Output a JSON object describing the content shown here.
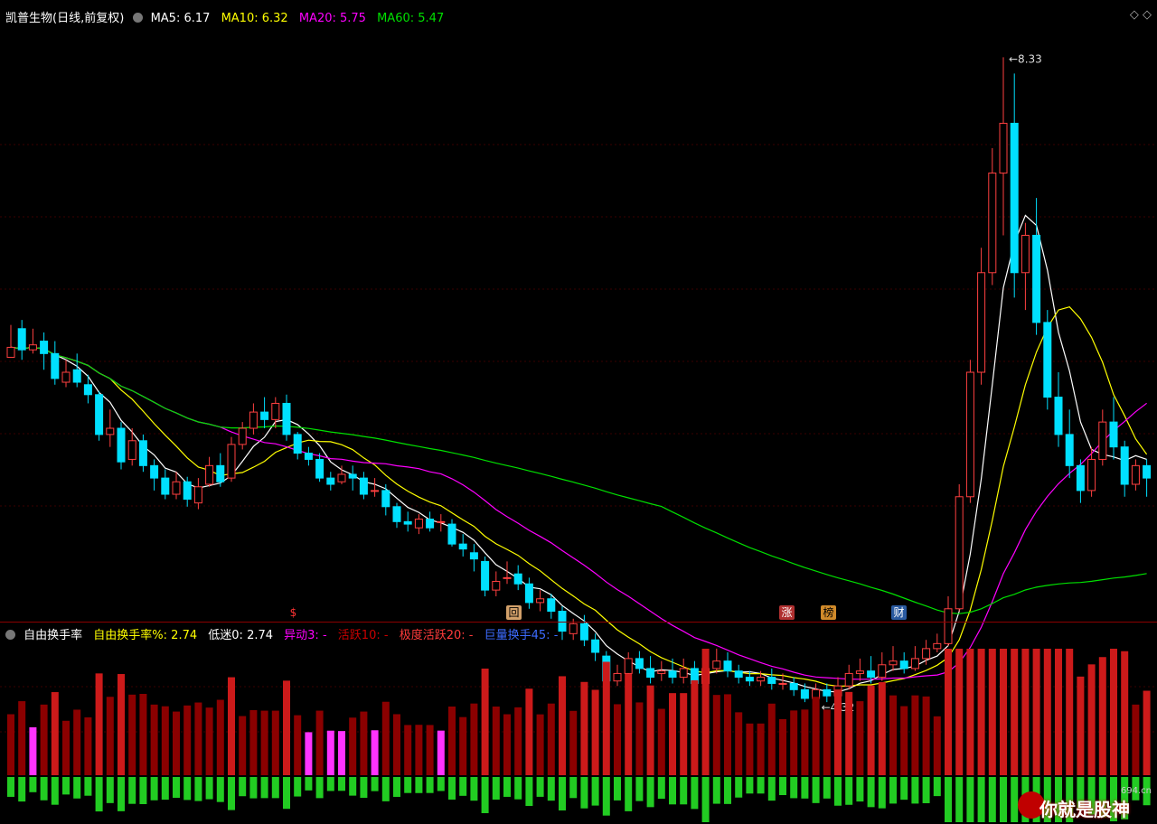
{
  "header": {
    "stock_name": "凯普生物(日线,前复权)",
    "ma5": {
      "label": "MA5:",
      "value": "6.17",
      "color": "#ffffff"
    },
    "ma10": {
      "label": "MA10:",
      "value": "6.32",
      "color": "#ffff00"
    },
    "ma20": {
      "label": "MA20:",
      "value": "5.75",
      "color": "#ff00ff"
    },
    "ma60": {
      "label": "MA60:",
      "value": "5.47",
      "color": "#00e000"
    }
  },
  "price_annotations": {
    "high": "8.33",
    "low": "4.32"
  },
  "markers": [
    {
      "label": "$",
      "color": "#ff3333",
      "bg": "#000000"
    },
    {
      "label": "回",
      "color": "#000000",
      "bg": "#d2a06a"
    },
    {
      "label": "涨",
      "color": "#ffffff",
      "bg": "#b03030"
    },
    {
      "label": "榜",
      "color": "#000000",
      "bg": "#d08a2a"
    },
    {
      "label": "财",
      "color": "#ffffff",
      "bg": "#2a5aa0"
    }
  ],
  "indicator": {
    "name": "自由换手率",
    "items": [
      {
        "label": "自由换手率%:",
        "value": "2.74",
        "color": "#ffff00"
      },
      {
        "label": "低迷0:",
        "value": "2.74",
        "color": "#ffffff"
      },
      {
        "label": "异动3:",
        "value": "-",
        "color": "#ff00ff"
      },
      {
        "label": "活跃10:",
        "value": "-",
        "color": "#cc0000"
      },
      {
        "label": "极度活跃20:",
        "value": "-",
        "color": "#ff3b3b"
      },
      {
        "label": "巨量换手45:",
        "value": "-",
        "color": "#3c6bff"
      }
    ]
  },
  "watermark": {
    "text": "你就是股神",
    "url": "694.cn"
  },
  "chart_data": {
    "type": "candlestick",
    "ylim": [
      4.0,
      8.5
    ],
    "candles": [
      [
        5.92,
        6.0,
        6.18,
        5.92
      ],
      [
        6.15,
        5.98,
        6.22,
        5.9
      ],
      [
        5.98,
        6.02,
        6.15,
        5.95
      ],
      [
        6.05,
        5.95,
        6.12,
        5.82
      ],
      [
        5.95,
        5.75,
        6.05,
        5.7
      ],
      [
        5.72,
        5.8,
        5.9,
        5.68
      ],
      [
        5.82,
        5.72,
        5.95,
        5.68
      ],
      [
        5.7,
        5.62,
        5.78,
        5.55
      ],
      [
        5.62,
        5.3,
        5.65,
        5.25
      ],
      [
        5.3,
        5.35,
        5.5,
        5.2
      ],
      [
        5.35,
        5.08,
        5.4,
        5.02
      ],
      [
        5.1,
        5.25,
        5.35,
        5.05
      ],
      [
        5.25,
        5.05,
        5.3,
        5.0
      ],
      [
        5.05,
        4.95,
        5.1,
        4.85
      ],
      [
        4.95,
        4.82,
        5.02,
        4.78
      ],
      [
        4.82,
        4.92,
        5.0,
        4.78
      ],
      [
        4.92,
        4.78,
        4.96,
        4.72
      ],
      [
        4.75,
        4.88,
        4.95,
        4.7
      ],
      [
        4.9,
        5.05,
        5.12,
        4.88
      ],
      [
        5.05,
        4.92,
        5.15,
        4.88
      ],
      [
        4.95,
        5.22,
        5.28,
        4.92
      ],
      [
        5.22,
        5.35,
        5.4,
        5.18
      ],
      [
        5.35,
        5.48,
        5.55,
        5.3
      ],
      [
        5.48,
        5.42,
        5.6,
        5.35
      ],
      [
        5.42,
        5.55,
        5.6,
        5.35
      ],
      [
        5.55,
        5.3,
        5.62,
        5.25
      ],
      [
        5.3,
        5.15,
        5.32,
        5.1
      ],
      [
        5.15,
        5.1,
        5.2,
        5.05
      ],
      [
        5.1,
        4.95,
        5.15,
        4.92
      ],
      [
        4.95,
        4.9,
        5.0,
        4.85
      ],
      [
        4.92,
        4.98,
        5.05,
        4.9
      ],
      [
        4.98,
        4.95,
        5.05,
        4.85
      ],
      [
        4.95,
        4.82,
        5.0,
        4.78
      ],
      [
        4.85,
        4.85,
        4.95,
        4.8
      ],
      [
        4.85,
        4.72,
        4.9,
        4.65
      ],
      [
        4.72,
        4.6,
        4.75,
        4.55
      ],
      [
        4.6,
        4.58,
        4.68,
        4.52
      ],
      [
        4.55,
        4.62,
        4.66,
        4.5
      ],
      [
        4.62,
        4.55,
        4.68,
        4.52
      ],
      [
        4.6,
        4.6,
        4.66,
        4.52
      ],
      [
        4.58,
        4.42,
        4.62,
        4.4
      ],
      [
        4.42,
        4.38,
        4.5,
        4.32
      ],
      [
        4.35,
        4.3,
        4.42,
        4.2
      ],
      [
        4.28,
        4.05,
        4.32,
        4.0
      ],
      [
        4.05,
        4.12,
        4.2,
        4.0
      ],
      [
        4.15,
        4.15,
        4.28,
        4.1
      ],
      [
        4.18,
        4.1,
        4.25,
        4.05
      ],
      [
        4.1,
        3.95,
        4.15,
        3.9
      ],
      [
        3.95,
        3.98,
        4.05,
        3.88
      ],
      [
        3.98,
        3.88,
        4.02,
        3.82
      ],
      [
        3.88,
        3.72,
        3.92,
        3.65
      ],
      [
        3.7,
        3.78,
        3.82,
        3.65
      ],
      [
        3.78,
        3.65,
        3.85,
        3.6
      ],
      [
        3.65,
        3.55,
        3.7,
        3.48
      ],
      [
        3.52,
        3.32,
        3.56,
        3.28
      ],
      [
        3.32,
        3.38,
        3.45,
        3.28
      ],
      [
        3.38,
        3.5,
        3.55,
        3.3
      ],
      [
        3.5,
        3.42,
        3.56,
        3.38
      ],
      [
        3.42,
        3.35,
        3.52,
        3.3
      ],
      [
        3.38,
        3.4,
        3.48,
        3.32
      ],
      [
        3.4,
        3.35,
        3.5,
        3.3
      ],
      [
        3.35,
        3.42,
        3.5,
        3.3
      ],
      [
        3.42,
        3.3,
        3.48,
        3.25
      ],
      [
        3.3,
        3.42,
        3.5,
        3.18
      ],
      [
        3.42,
        3.48,
        3.58,
        3.38
      ],
      [
        3.48,
        3.4,
        3.55,
        3.35
      ],
      [
        3.4,
        3.35,
        3.45,
        3.3
      ],
      [
        3.35,
        3.32,
        3.4,
        3.28
      ],
      [
        3.32,
        3.35,
        3.4,
        3.28
      ],
      [
        3.35,
        3.3,
        3.42,
        3.25
      ],
      [
        3.3,
        3.3,
        3.38,
        3.25
      ],
      [
        3.3,
        3.25,
        3.35,
        3.2
      ],
      [
        3.25,
        3.18,
        3.3,
        3.15
      ],
      [
        3.18,
        3.25,
        3.3,
        3.12
      ],
      [
        3.25,
        3.2,
        3.3,
        3.15
      ],
      [
        3.2,
        3.28,
        3.35,
        3.15
      ],
      [
        3.28,
        3.38,
        3.45,
        3.25
      ],
      [
        3.38,
        3.4,
        3.5,
        3.32
      ],
      [
        3.4,
        3.35,
        3.52,
        3.3
      ],
      [
        3.35,
        3.45,
        3.55,
        3.32
      ],
      [
        3.45,
        3.48,
        3.6,
        3.4
      ],
      [
        3.48,
        3.42,
        3.55,
        3.38
      ],
      [
        3.42,
        3.5,
        3.6,
        3.4
      ],
      [
        3.5,
        3.58,
        3.65,
        3.45
      ],
      [
        3.58,
        3.62,
        3.7,
        3.55
      ],
      [
        3.62,
        3.9,
        4.0,
        3.6
      ],
      [
        3.9,
        4.8,
        4.9,
        3.88
      ],
      [
        4.8,
        5.8,
        5.9,
        4.75
      ],
      [
        5.8,
        6.6,
        6.8,
        5.7
      ],
      [
        6.6,
        7.4,
        7.6,
        6.5
      ],
      [
        7.4,
        7.8,
        8.33,
        6.9
      ],
      [
        7.8,
        6.6,
        8.2,
        6.4
      ],
      [
        6.6,
        6.9,
        7.0,
        6.3
      ],
      [
        6.9,
        6.2,
        7.2,
        6.1
      ],
      [
        6.2,
        5.6,
        6.3,
        5.5
      ],
      [
        5.6,
        5.3,
        5.8,
        5.2
      ],
      [
        5.3,
        5.05,
        5.5,
        4.95
      ],
      [
        5.05,
        4.85,
        5.1,
        4.75
      ],
      [
        4.85,
        5.1,
        5.2,
        4.8
      ],
      [
        5.1,
        5.4,
        5.5,
        5.05
      ],
      [
        5.4,
        5.2,
        5.6,
        5.1
      ],
      [
        5.2,
        4.9,
        5.25,
        4.8
      ],
      [
        4.9,
        5.05,
        5.1,
        4.85
      ],
      [
        5.05,
        4.95,
        5.1,
        4.8
      ]
    ],
    "ma5": [],
    "ma10": [],
    "ma20": [],
    "ma60": []
  }
}
